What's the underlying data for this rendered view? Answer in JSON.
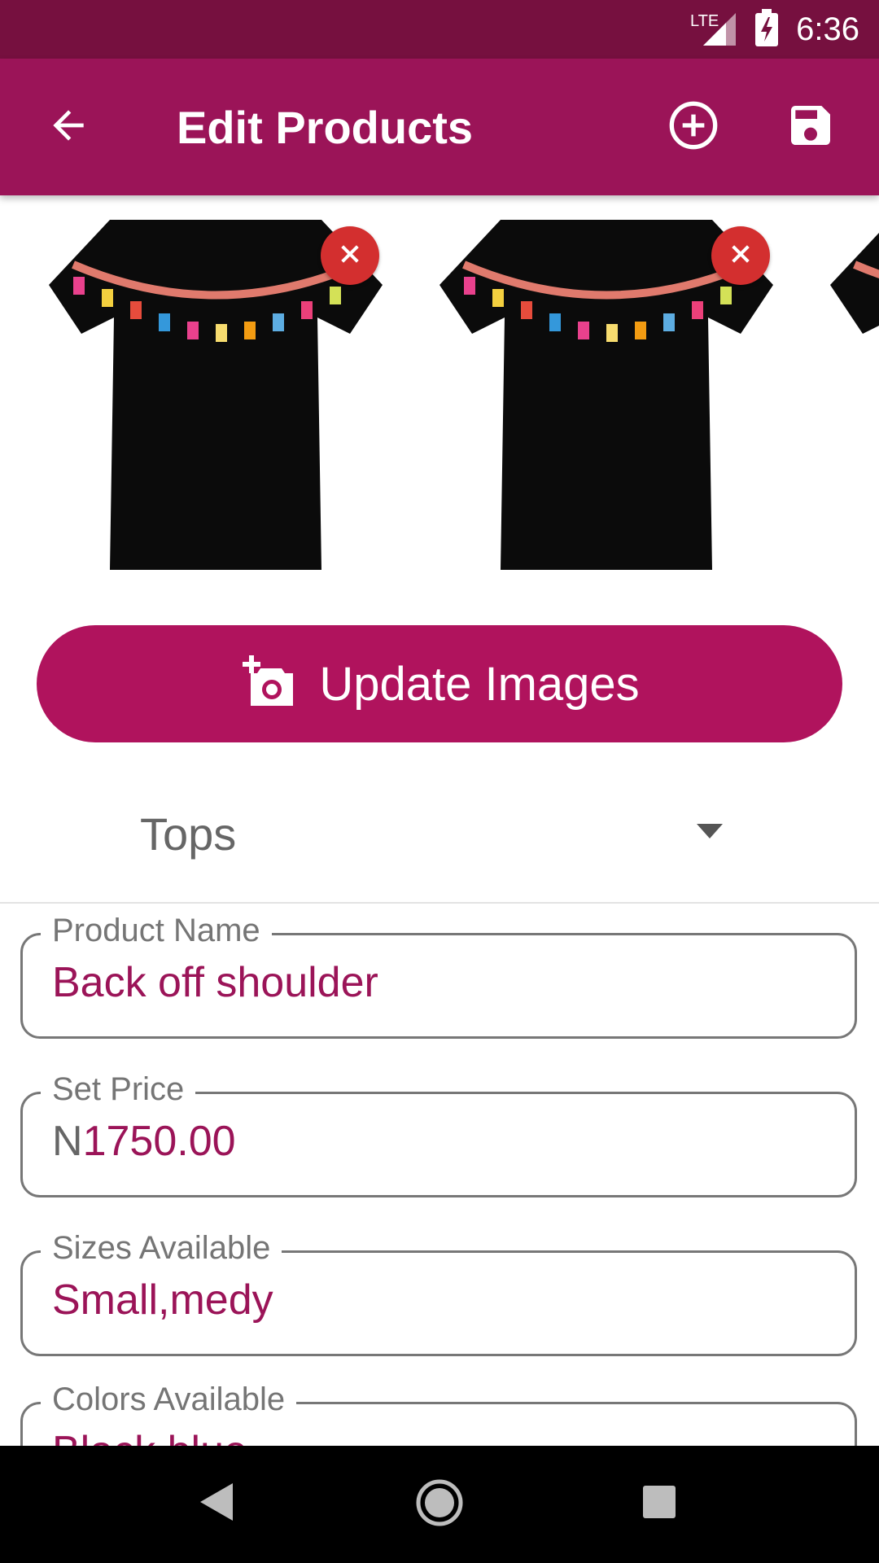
{
  "status_bar": {
    "network": "LTE",
    "time": "6:36"
  },
  "app_bar": {
    "title": "Edit Products",
    "back_icon": "arrow-back-icon",
    "add_icon": "add-circle-icon",
    "save_icon": "save-icon"
  },
  "images": {
    "count_visible": 3,
    "remove_icon": "close-icon",
    "product_image": "black tassel t-shirt"
  },
  "update_button": {
    "label": "Update Images",
    "icon": "add-photo-icon"
  },
  "category": {
    "selected": "Tops"
  },
  "fields": {
    "product_name": {
      "label": "Product Name",
      "value": "Back off shoulder"
    },
    "price": {
      "label": "Set Price",
      "prefix": "N",
      "value": "1750.00"
    },
    "sizes": {
      "label": "Sizes Available",
      "value": "Small,medy"
    },
    "colors": {
      "label": "Colors Available",
      "value": "Black,blue"
    }
  },
  "colors": {
    "status_bar": "#76103f",
    "app_bar": "#9b1458",
    "button": "#b0135d",
    "accent_text": "#9b1458",
    "remove": "#d32f2f"
  }
}
